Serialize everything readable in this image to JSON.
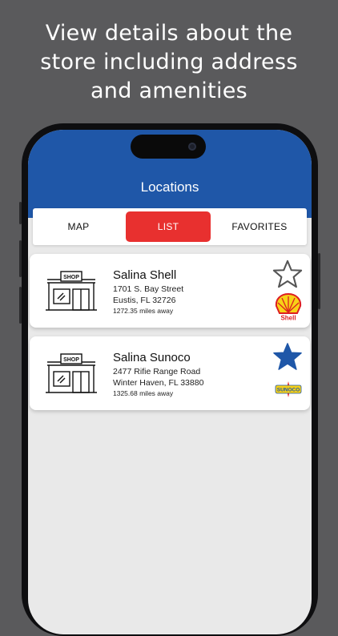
{
  "headline": {
    "line1": "View details about the",
    "line2": "store including address",
    "line3": "and amenities"
  },
  "header": {
    "title": "Locations"
  },
  "tabs": [
    {
      "label": "MAP",
      "active": false
    },
    {
      "label": "LIST",
      "active": true
    },
    {
      "label": "FAVORITES",
      "active": false
    }
  ],
  "stores": [
    {
      "name": "Salina Shell",
      "address_line1": "1701 S. Bay Street",
      "address_line2": "Eustis, FL 32726",
      "distance": "1272.35 miles away",
      "favorite": false,
      "brand": "Shell",
      "brand_label": "Shell",
      "shop_sign": "SHOP"
    },
    {
      "name": "Salina Sunoco",
      "address_line1": "2477 Rifie Range Road",
      "address_line2": "Winter Haven, FL 33880",
      "distance": "1325.68 miles away",
      "favorite": true,
      "brand": "Sunoco",
      "brand_label": "SUNOCO",
      "shop_sign": "SHOP"
    }
  ],
  "colors": {
    "appbar": "#1f57a8",
    "active_tab": "#e8302f",
    "favorite_star": "#1f57a8",
    "background": "#5a5a5c"
  }
}
